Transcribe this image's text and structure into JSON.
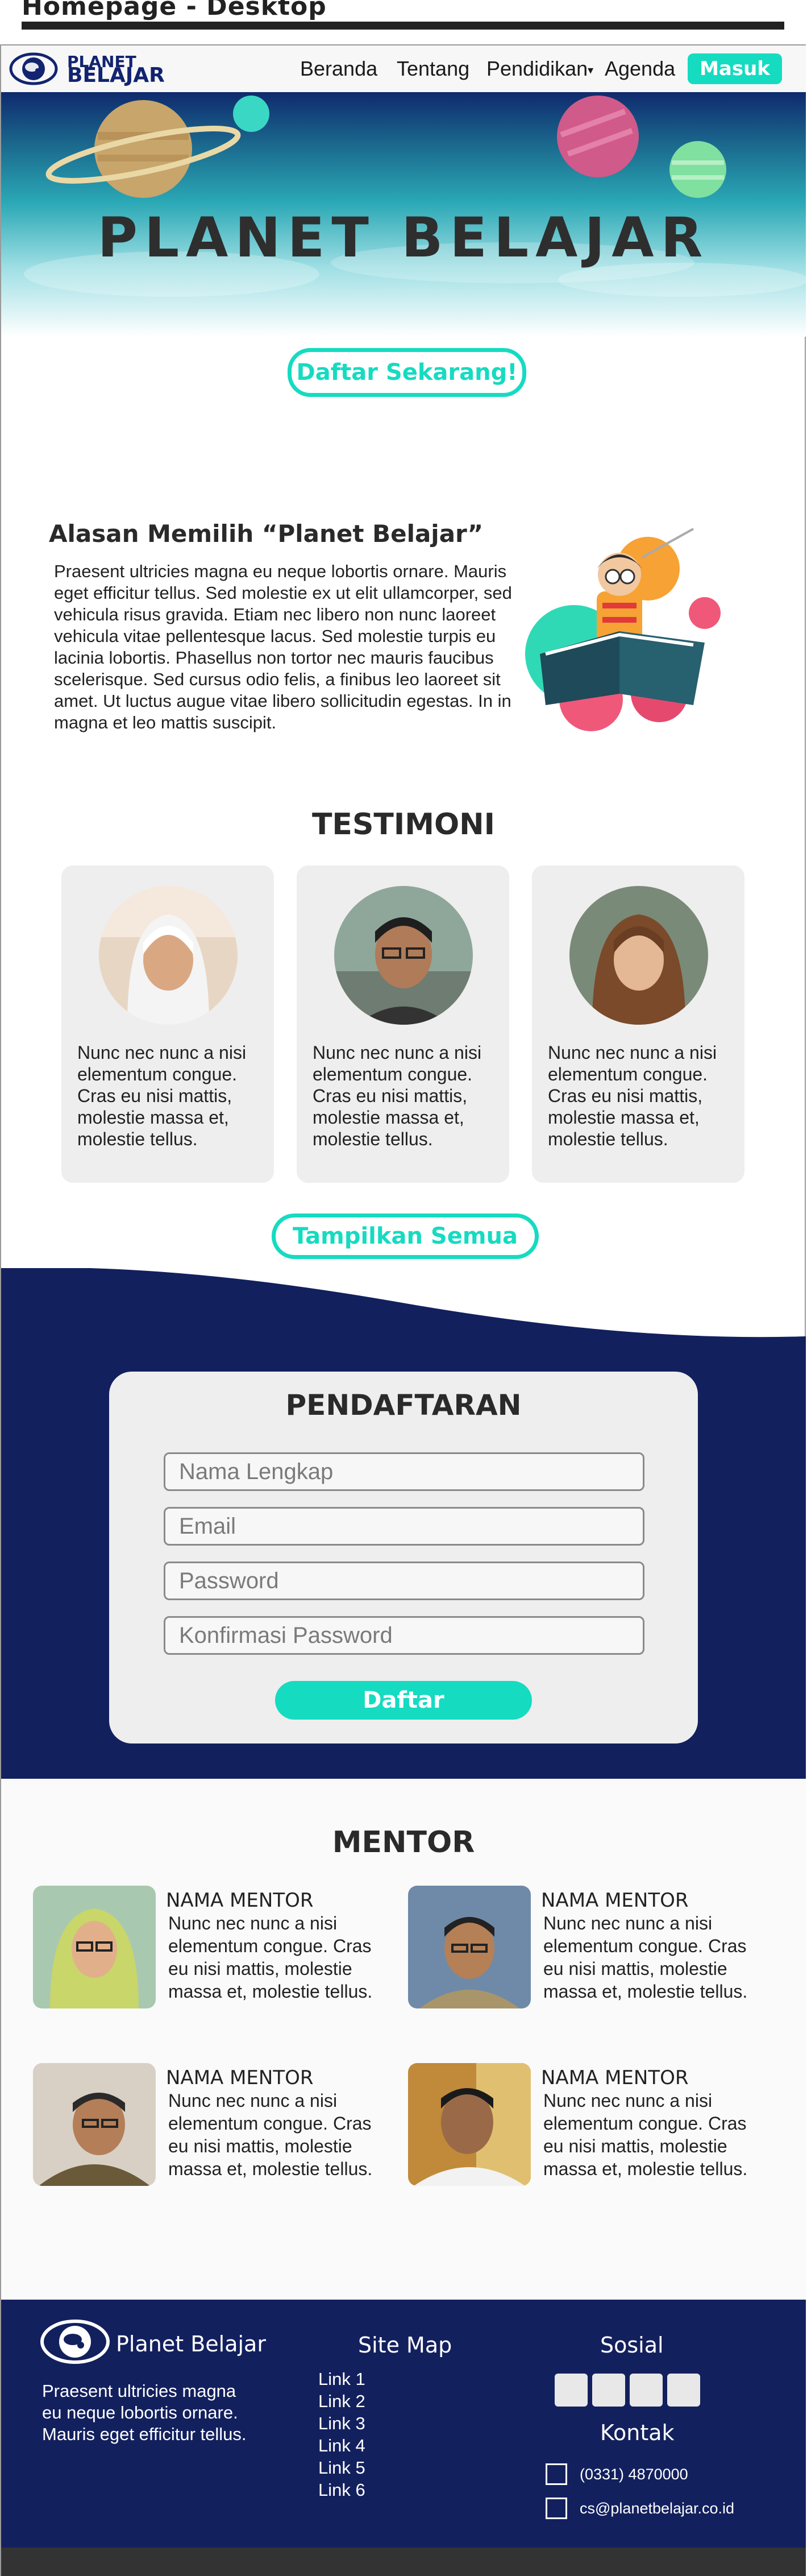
{
  "doc": {
    "title": "Homepage - Desktop"
  },
  "nav": {
    "logo_top": "PLANET",
    "logo_bottom": "BELAJAR",
    "links": [
      "Beranda",
      "Tentang",
      "Pendidikan",
      "Agenda"
    ],
    "caret": "▾",
    "login": "Masuk"
  },
  "hero": {
    "title": "PLANET BELAJAR",
    "cta": "Daftar Sekarang!"
  },
  "about": {
    "heading": "Alasan Memilih “Planet Belajar”",
    "body": "Praesent ultricies magna eu neque lobortis ornare. Mauris eget efficitur tellus. Sed molestie ex ut elit ullamcorper, sed vehicula risus gravida. Etiam nec libero non nunc laoreet vehicula vitae pellentesque lacus. Sed molestie turpis eu lacinia lobortis. Phasellus non tortor nec mauris faucibus scelerisque. Sed cursus odio felis, a finibus leo laoreet sit amet. Ut luctus augue vitae libero sollicitudin egestas. In in magna et leo mattis suscipit."
  },
  "testimoni": {
    "heading": "TESTIMONI",
    "items": [
      {
        "text": "Nunc nec nunc a nisi elementum congue. Cras eu nisi mattis, molestie massa et, molestie tellus."
      },
      {
        "text": "Nunc nec nunc a nisi elementum congue. Cras eu nisi mattis, molestie massa et, molestie tellus."
      },
      {
        "text": "Nunc nec nunc a nisi elementum congue. Cras eu nisi mattis, molestie massa et, molestie tellus."
      }
    ],
    "show_all": "Tampilkan Semua"
  },
  "register": {
    "heading": "PENDAFTARAN",
    "fields": {
      "name": "Nama Lengkap",
      "email": "Email",
      "password": "Password",
      "confirm": "Konfirmasi Password"
    },
    "submit": "Daftar"
  },
  "mentor": {
    "heading": "MENTOR",
    "items": [
      {
        "name": "NAMA MENTOR",
        "text": "Nunc nec nunc a nisi elementum congue. Cras eu nisi mattis, molestie massa et, molestie tellus."
      },
      {
        "name": "NAMA MENTOR",
        "text": "Nunc nec nunc a nisi elementum congue. Cras eu nisi mattis, molestie massa et, molestie tellus."
      },
      {
        "name": "NAMA MENTOR",
        "text": "Nunc nec nunc a nisi elementum congue. Cras eu nisi mattis, molestie massa et, molestie tellus."
      },
      {
        "name": "NAMA MENTOR",
        "text": "Nunc nec nunc a nisi elementum congue. Cras eu nisi mattis, molestie massa et, molestie tellus."
      }
    ]
  },
  "footer": {
    "brand": "Planet Belajar",
    "about": "Praesent ultricies magna eu neque lobortis ornare. Mauris eget efficitur tellus.",
    "sitemap_title": "Site Map",
    "links": [
      "Link 1",
      "Link 2",
      "Link 3",
      "Link 4",
      "Link 5",
      "Link 6"
    ],
    "social_title": "Sosial",
    "contact_title": "Kontak",
    "phone": "(0331) 4870000",
    "email": "cs@planetbelajar.co.id"
  },
  "colors": {
    "accent": "#15dbc1",
    "navy": "#13205e",
    "panel": "#eeeeee"
  },
  "icons": [
    "planet-logo-icon",
    "caret-down-icon",
    "phone-icon",
    "mail-icon"
  ]
}
